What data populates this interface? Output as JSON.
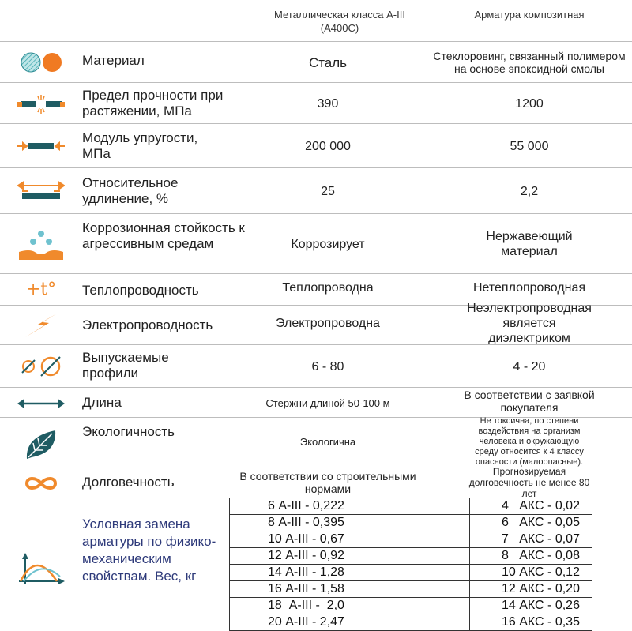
{
  "header": {
    "col1": "Металлическая класса А-III (А400С)",
    "col2": "Арматура композитная"
  },
  "rows": [
    {
      "label": "Материал",
      "steel": "Сталь",
      "composite": "Стеклоровинг, связанный полимером на основе эпоксидной смолы",
      "icon": "material-circles-icon"
    },
    {
      "label": "Предел прочности при растяжении, МПа",
      "steel": "390",
      "composite": "1200",
      "icon": "rebar-break-icon"
    },
    {
      "label": "Модуль упругости, МПа",
      "steel": "200 000",
      "composite": "55 000",
      "icon": "rebar-compress-icon"
    },
    {
      "label": "Относительное удлинение, %",
      "steel": "25",
      "composite": "2,2",
      "icon": "rebar-stretch-icon"
    },
    {
      "label": "Коррозионная стойкость к агрессивным средам",
      "steel": "Коррозирует",
      "composite": "Нержавеющий материал",
      "icon": "drops-icon"
    },
    {
      "label": "Теплопроводность",
      "steel": "Теплопроводна",
      "composite": "Нетеплопроводная",
      "icon": "temperature-icon",
      "icon_text": "+t°"
    },
    {
      "label": "Электропроводность",
      "steel": "Электропроводна",
      "composite": "Неэлектропроводная является диэлектриком",
      "icon": "lightning-icon"
    },
    {
      "label": "Выпускаемые профили",
      "steel": "6 - 80",
      "composite": "4 - 20",
      "icon": "diameter-icon"
    },
    {
      "label": "Длина",
      "steel": "Стержни длиной 50-100 м",
      "composite": "В соответствии с заявкой покупателя",
      "icon": "double-arrow-icon"
    },
    {
      "label": "Экологичность",
      "steel": "Экологична",
      "composite": "Не токсична, по степени воздействия на организм человека и окружающую среду относится к 4 классу опасности (малоопасные).",
      "icon": "leaf-icon"
    },
    {
      "label": "Долговечность",
      "steel": "В соответствии со строительными нормами",
      "composite": "Прогнозируемая долговечность не менее 80 лет",
      "icon": "infinity-icon"
    }
  ],
  "replacement": {
    "label": "Условная замена арматуры по физико-механическим свойствам. Вес, кг",
    "steel": [
      "6 А-III - 0,222",
      "8 А-III - 0,395",
      "10 А-III - 0,67",
      "12 А-III - 0,92",
      "14 А-III - 1,28",
      "16 А-III - 1,58",
      "18  А-III -  2,0",
      "20 А-III - 2,47"
    ],
    "composite": [
      "4   АКС - 0,02",
      "6   АКС - 0,05",
      "7   АКС - 0,07",
      "8   АКС - 0,08",
      "10 АКС - 0,12",
      "12 АКС - 0,20",
      "14 АКС - 0,26",
      "16 АКС - 0,35"
    ]
  },
  "colors": {
    "orange": "#f08a2c",
    "teal": "#1f5c63",
    "navy": "#2e3a7a"
  }
}
